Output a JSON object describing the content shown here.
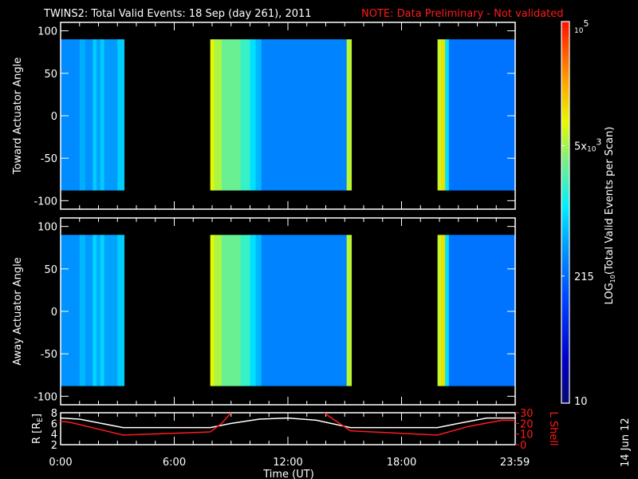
{
  "chart_data": {
    "type": "heatmap",
    "title": "TWINS2: Total Valid Events: 18 Sep (day 261), 2011",
    "note": "NOTE: Data Preliminary - Not validated",
    "xlabel": "Time (UT)",
    "x_ticks": [
      "0:00",
      "6:00",
      "12:00",
      "18:00",
      "23:59"
    ],
    "x_tick_hours": [
      0,
      6,
      12,
      18,
      23.983
    ],
    "xlim_hours": [
      0,
      24
    ],
    "colorbar": {
      "label": "LOG10(Total Valid Events per Scan)",
      "label_main": "LOG",
      "label_sub": "10",
      "label_rest": "(Total Valid Events per Scan)",
      "scale": "log",
      "range": [
        10,
        100000
      ],
      "ticks": [
        {
          "value": 100000,
          "base": "10",
          "exp": "5",
          "prefix": ""
        },
        {
          "value": 5000,
          "base": "10",
          "exp": "3",
          "prefix": "5x"
        },
        {
          "value": 215,
          "base": "215",
          "exp": "",
          "prefix": ""
        },
        {
          "value": 10,
          "base": "10",
          "exp": "",
          "prefix": ""
        }
      ]
    },
    "panels": [
      {
        "ylabel": "Toward Actuator Angle",
        "ylim": [
          -110,
          110
        ],
        "y_ticks": [
          "100",
          "50",
          "0",
          "-50",
          "-100"
        ],
        "y_tick_values": [
          100,
          50,
          0,
          -50,
          -100
        ],
        "angle_range": [
          -88,
          90
        ],
        "bands_hours_log10": [
          [
            0,
            1.0,
            2.55
          ],
          [
            1.0,
            1.3,
            2.75
          ],
          [
            1.3,
            1.7,
            2.6
          ],
          [
            1.7,
            1.9,
            2.9
          ],
          [
            1.9,
            2.1,
            2.7
          ],
          [
            2.1,
            2.3,
            2.9
          ],
          [
            2.3,
            3.0,
            2.65
          ],
          [
            3.0,
            3.35,
            2.9
          ],
          [
            7.9,
            8.1,
            3.95
          ],
          [
            8.1,
            8.5,
            3.75
          ],
          [
            8.5,
            9.5,
            3.5
          ],
          [
            9.5,
            10.0,
            3.3
          ],
          [
            10.0,
            10.3,
            3.0
          ],
          [
            10.3,
            10.6,
            2.8
          ],
          [
            10.6,
            15.1,
            2.5
          ],
          [
            15.1,
            15.35,
            3.8
          ],
          [
            19.9,
            20.1,
            3.85
          ],
          [
            20.1,
            20.3,
            4.1
          ],
          [
            20.3,
            20.5,
            3.0
          ],
          [
            20.5,
            24,
            2.4
          ]
        ]
      },
      {
        "ylabel": "Away Actuator Angle",
        "ylim": [
          -110,
          110
        ],
        "y_ticks": [
          "100",
          "50",
          "0",
          "-50",
          "-100"
        ],
        "y_tick_values": [
          100,
          50,
          0,
          -50,
          -100
        ],
        "angle_range": [
          -88,
          90
        ],
        "bands_hours_log10": [
          [
            0,
            1.0,
            2.6
          ],
          [
            1.0,
            1.3,
            2.8
          ],
          [
            1.3,
            1.7,
            2.65
          ],
          [
            1.7,
            1.9,
            2.95
          ],
          [
            1.9,
            2.1,
            2.75
          ],
          [
            2.1,
            2.3,
            2.95
          ],
          [
            2.3,
            3.0,
            2.7
          ],
          [
            3.0,
            3.35,
            2.9
          ],
          [
            7.9,
            8.1,
            3.95
          ],
          [
            8.1,
            8.5,
            3.75
          ],
          [
            8.5,
            9.5,
            3.5
          ],
          [
            9.5,
            10.0,
            3.3
          ],
          [
            10.0,
            10.3,
            3.0
          ],
          [
            10.3,
            10.6,
            2.8
          ],
          [
            10.6,
            15.1,
            2.5
          ],
          [
            15.1,
            15.35,
            3.8
          ],
          [
            19.9,
            20.1,
            3.85
          ],
          [
            20.1,
            20.3,
            4.1
          ],
          [
            20.3,
            20.5,
            3.0
          ],
          [
            20.5,
            24,
            2.4
          ]
        ]
      }
    ],
    "orbit": {
      "left_label": "R [RE]",
      "left_label_main": "R [R",
      "left_label_sub": "E",
      "left_label_end": "]",
      "right_label": "L Shell",
      "left_ticks": [
        "8",
        "6",
        "4",
        "2"
      ],
      "left_tick_values": [
        8,
        6,
        4,
        2
      ],
      "left_ylim": [
        2,
        8
      ],
      "right_ticks": [
        "30",
        "20",
        "10",
        "0"
      ],
      "right_tick_values": [
        30,
        20,
        10,
        0
      ],
      "right_ylim": [
        0,
        30
      ],
      "r_series": {
        "name": "R",
        "color": "#ffffff",
        "x": [
          0,
          1,
          3.3,
          7.9,
          9,
          10.5,
          12,
          13.5,
          15.3,
          19.9,
          21,
          22.5,
          24
        ],
        "y": [
          7.0,
          6.8,
          5.2,
          5.2,
          6.0,
          6.8,
          7.0,
          6.6,
          5.2,
          5.2,
          6.0,
          7.0,
          7.0
        ]
      },
      "l_series": {
        "name": "L Shell",
        "color": "#ff1a1a",
        "segments": [
          {
            "x": [
              0,
              0.5,
              3.3,
              7.9,
              8.5,
              9.0
            ],
            "y": [
              22,
              21,
              9,
              12,
              20,
              30
            ]
          },
          {
            "x": [
              13.9,
              15.3,
              19.9,
              21.5,
              23.3,
              24
            ],
            "y": [
              30,
              13,
              9,
              17,
              23,
              23
            ]
          }
        ]
      }
    },
    "footer_date": "14 Jun 12"
  }
}
